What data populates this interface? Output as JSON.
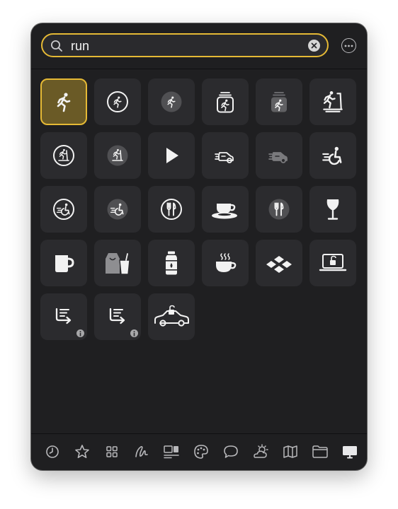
{
  "search": {
    "query": "run"
  },
  "colors": {
    "accent": "#e5b935",
    "panel_background": "#1f1f21",
    "cell_background": "#2b2b2e",
    "icon_color": "#f2f2f2"
  },
  "results": [
    {
      "icon": "figure-run-icon",
      "selected": true
    },
    {
      "icon": "figure-run-circle-icon"
    },
    {
      "icon": "figure-run-circle-fill-icon"
    },
    {
      "icon": "figure-run-square-stack-icon"
    },
    {
      "icon": "figure-run-square-stack-fill-icon"
    },
    {
      "icon": "figure-run-treadmill-icon"
    },
    {
      "icon": "figure-run-treadmill-circle-icon"
    },
    {
      "icon": "figure-run-treadmill-circle-fill-icon"
    },
    {
      "icon": "play-fill-icon"
    },
    {
      "icon": "car-rear-waves-icon"
    },
    {
      "icon": "car-rear-waves-fill-icon"
    },
    {
      "icon": "figure-roll-runningpace-icon"
    },
    {
      "icon": "figure-roll-runningpace-circle-icon"
    },
    {
      "icon": "figure-roll-runningpace-circle-fill-icon"
    },
    {
      "icon": "fork-knife-circle-icon"
    },
    {
      "icon": "cup-and-saucer-fill-icon"
    },
    {
      "icon": "fork-knife-circle-fill-icon"
    },
    {
      "icon": "wineglass-fill-icon"
    },
    {
      "icon": "mug-fill-icon"
    },
    {
      "icon": "takeoutbag-and-cup-fill-icon"
    },
    {
      "icon": "waterbottle-fill-icon"
    },
    {
      "icon": "cup-and-heat-waves-fill-icon"
    },
    {
      "icon": "square-stack-diamonds-icon"
    },
    {
      "icon": "laptop-lock-open-icon"
    },
    {
      "icon": "arrow-turn-down-right-list-icon",
      "info_badge": true
    },
    {
      "icon": "arrow-turn-down-right-list-alt-icon",
      "info_badge": true
    },
    {
      "icon": "car-side-lock-open-icon"
    }
  ],
  "tabs": [
    {
      "icon": "clock-icon"
    },
    {
      "icon": "star-icon"
    },
    {
      "icon": "grid-icon"
    },
    {
      "icon": "scribble-icon"
    },
    {
      "icon": "rectangle-on-rectangle-icon"
    },
    {
      "icon": "paintpalette-icon"
    },
    {
      "icon": "speech-bubble-icon"
    },
    {
      "icon": "sun-cloud-icon"
    },
    {
      "icon": "map-icon"
    },
    {
      "icon": "folder-icon"
    },
    {
      "icon": "desktop-computer-icon",
      "active": true
    }
  ]
}
